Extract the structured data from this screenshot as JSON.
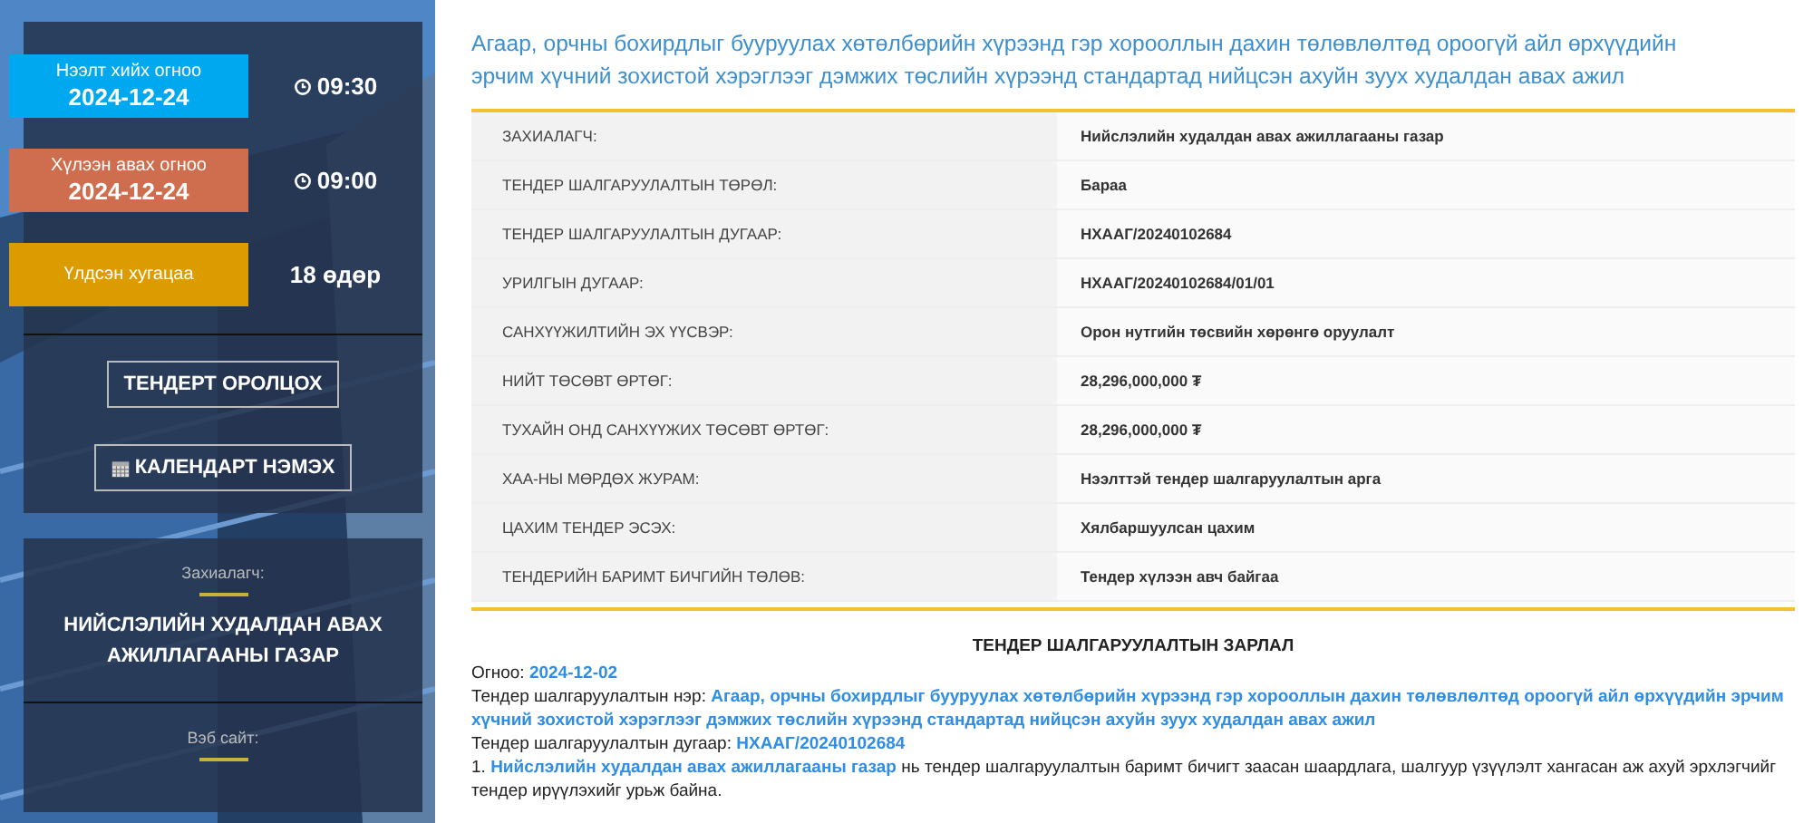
{
  "sidebar": {
    "dates": [
      {
        "kind": "open",
        "label": "Нээлт хийх огноо",
        "date": "2024-12-24",
        "time": "09:30",
        "color": "#00a8f0"
      },
      {
        "kind": "receive",
        "label": "Хүлээн авах огноо",
        "date": "2024-12-24",
        "time": "09:00",
        "color": "#cf6e4f"
      },
      {
        "kind": "remaining",
        "label": "Үлдсэн хугацаа",
        "value": "18 өдөр",
        "color": "#dc9c00"
      }
    ],
    "buttons": [
      {
        "kind": "plain",
        "label": "ТЕНДЕРТ ОРОЛЦОХ"
      },
      {
        "kind": "calendar",
        "label": "КАЛЕНДАРТ НЭМЭХ"
      }
    ],
    "customer": {
      "label": "Захиалагч:",
      "value": "НИЙСЛЭЛИЙН ХУДАЛДАН АВАХ АЖИЛЛАГААНЫ ГАЗАР"
    },
    "website": {
      "label": "Вэб сайт:"
    }
  },
  "title": "Агаар, орчны бохирдлыг бууруулах хөтөлбөрийн хүрээнд гэр хорооллын дахин төлөвлөлтөд ороогүй айл өрхүүдийн эрчим хүчний зохистой хэрэглээг дэмжих төслийн хүрээнд стандартад нийцсэн ахуйн зуух худалдан авах ажил",
  "details": [
    {
      "label": "ЗАХИАЛАГЧ:",
      "value": "Нийслэлийн худалдан авах ажиллагааны газар"
    },
    {
      "label": "ТЕНДЕР ШАЛГАРУУЛАЛТЫН ТӨРӨЛ:",
      "value": "Бараа"
    },
    {
      "label": "ТЕНДЕР ШАЛГАРУУЛАЛТЫН ДУГААР:",
      "value": "НХААГ/20240102684"
    },
    {
      "label": "УРИЛГЫН ДУГААР:",
      "value": "НХААГ/20240102684/01/01"
    },
    {
      "label": "САНХҮҮЖИЛТИЙН ЭХ ҮҮСВЭР:",
      "value": "Орон нутгийн төсвийн хөрөнгө оруулалт"
    },
    {
      "label": "НИЙТ ТӨСӨВТ ӨРТӨГ:",
      "value": "28,296,000,000 ₮"
    },
    {
      "label": "ТУХАЙН ОНД САНХҮҮЖИХ ТӨСӨВТ ӨРТӨГ:",
      "value": "28,296,000,000 ₮"
    },
    {
      "label": "ХАА-НЫ МӨРДӨХ ЖУРАМ:",
      "value": "Нээлттэй тендер шалгаруулалтын арга"
    },
    {
      "label": "ЦАХИМ ТЕНДЕР ЭСЭХ:",
      "value": "Хялбаршуулсан цахим"
    },
    {
      "label": "ТЕНДЕРИЙН БАРИМТ БИЧГИЙН ТӨЛӨВ:",
      "value": "Тендер хүлээн авч байгаа"
    }
  ],
  "announcement": {
    "heading": "ТЕНДЕР ШАЛГАРУУЛАЛТЫН ЗАРЛАЛ",
    "lines": [
      "Огноо: **2024-12-02**",
      "Тендер шалгаруулалтын нэр: **Агаар, орчны бохирдлыг бууруулах хөтөлбөрийн хүрээнд гэр хорооллын дахин төлөвлөлтөд ороогүй айл өрхүүдийн эрчим хүчний зохистой хэрэглээг дэмжих төслийн хүрээнд стандартад нийцсэн ахуйн зуух худалдан авах ажил**",
      "Тендер шалгаруулалтын дугаар: **НХААГ/20240102684**",
      "1. **Нийслэлийн худалдан авах ажиллагааны газар** нь тендер шалгаруулалтын баримт бичигт заасан шаардлага, шалгуур үзүүлэлт хангасан аж ахуй эрхлэгчийг тендер ирүүлэхийг урьж байна."
    ]
  }
}
